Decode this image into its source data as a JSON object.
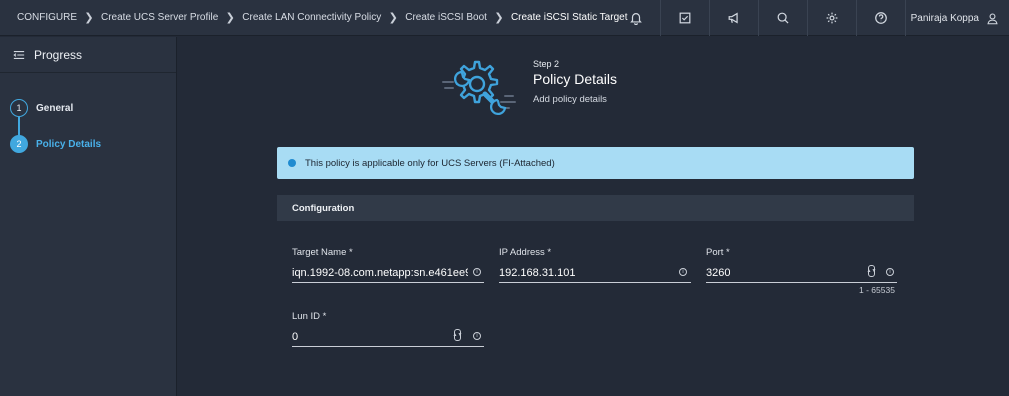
{
  "header": {
    "breadcrumbs": [
      "CONFIGURE",
      "Create UCS Server Profile",
      "Create LAN Connectivity Policy",
      "Create iSCSI Boot",
      "Create iSCSI Static Target"
    ],
    "user_name": "Paniraja Koppa",
    "icons": [
      "bell-icon",
      "tasks-icon",
      "megaphone-icon",
      "search-icon",
      "gear-icon",
      "help-icon",
      "user-icon"
    ]
  },
  "sidebar": {
    "title": "Progress",
    "steps": [
      {
        "number": "1",
        "label": "General"
      },
      {
        "number": "2",
        "label": "Policy Details"
      }
    ],
    "active_step": 2
  },
  "wizard": {
    "step_caption": "Step 2",
    "title": "Policy Details",
    "subtitle": "Add policy details"
  },
  "banner": {
    "text": "This policy is applicable only for UCS Servers (FI-Attached)"
  },
  "section": {
    "title": "Configuration"
  },
  "form": {
    "target_name": {
      "label": "Target Name *",
      "value": "iqn.1992-08.com.netapp:sn.e461ee9"
    },
    "ip_address": {
      "label": "IP Address *",
      "value": "192.168.31.101"
    },
    "port": {
      "label": "Port *",
      "value": "3260",
      "range": "1 - 65535"
    },
    "lun_id": {
      "label": "Lun ID *",
      "value": "0"
    }
  },
  "colors": {
    "accent": "#41a8df",
    "banner_bg": "#a8dcf4",
    "page_bg": "#232a37"
  }
}
